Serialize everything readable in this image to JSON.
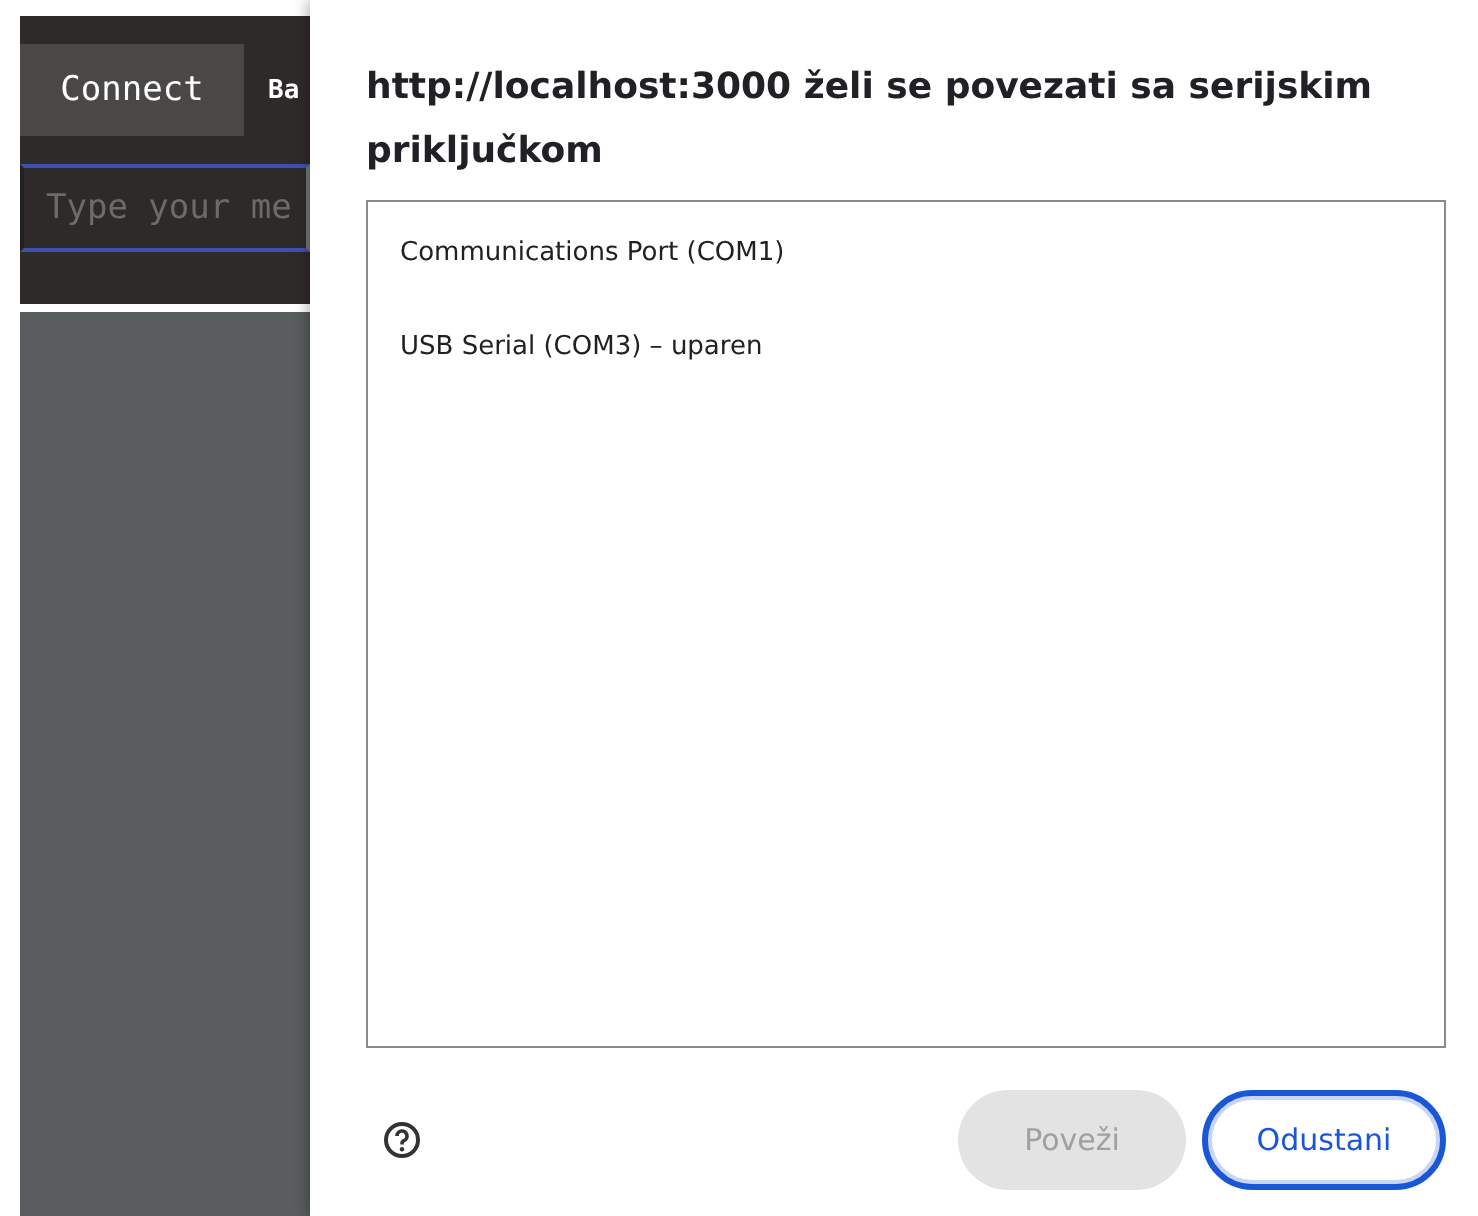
{
  "background_app": {
    "connect_button": "Connect",
    "button_2": "Ba",
    "message_field": {
      "placeholder": "Type your me"
    }
  },
  "dialog": {
    "title": "http://localhost:3000 želi se povezati sa serijskim priključkom",
    "ports": [
      {
        "label": "Communications Port (COM1)",
        "selected": false
      },
      {
        "label": "USB Serial (COM3) – uparen",
        "selected": false
      }
    ],
    "buttons": [
      {
        "label": "Poveži",
        "kind": "primary",
        "disabled": true
      },
      {
        "label": "Odustani",
        "kind": "secondary",
        "disabled": false
      }
    ]
  }
}
